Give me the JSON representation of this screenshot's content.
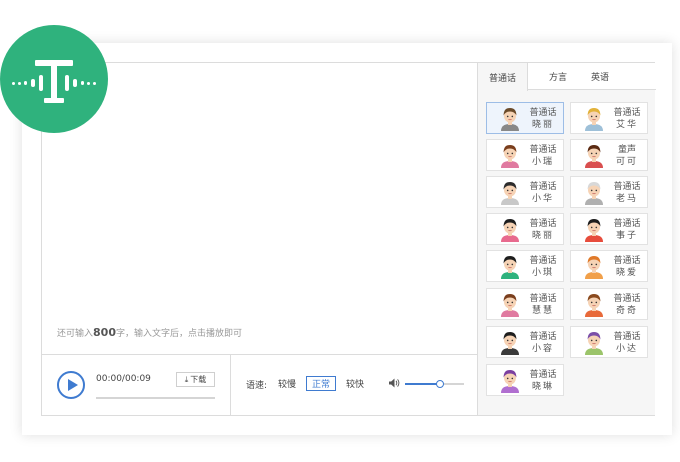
{
  "editor": {
    "hint_prefix": "还可输入",
    "hint_count": "800",
    "hint_suffix": "字，输入文字后，点击播放即可"
  },
  "player": {
    "time": "00:00/00:09",
    "download_label": "下载",
    "progress": 0
  },
  "speed": {
    "label": "语速:",
    "options": [
      "较慢",
      "正常",
      "较快"
    ],
    "selected": "正常"
  },
  "volume": {
    "level": 0.6
  },
  "colors": {
    "brand_green": "#2fb27d",
    "accent_blue": "#3f7bd0"
  },
  "tabs": [
    {
      "label": "普通话",
      "active": true
    },
    {
      "label": "方言",
      "active": false
    },
    {
      "label": "英语",
      "active": false
    }
  ],
  "voices": [
    {
      "lang": "普通话",
      "name": "晓丽",
      "selected": true,
      "avatar": "woman-glasses-avatar"
    },
    {
      "lang": "普通话",
      "name": "艾华",
      "selected": false,
      "avatar": "blonde-man-avatar"
    },
    {
      "lang": "普通话",
      "name": "小瑞",
      "selected": false,
      "avatar": "woman-brown-hair-avatar"
    },
    {
      "lang": "童声",
      "name": "可可",
      "selected": false,
      "avatar": "child-girl-avatar"
    },
    {
      "lang": "普通话",
      "name": "小华",
      "selected": false,
      "avatar": "man-black-hair-avatar"
    },
    {
      "lang": "普通话",
      "name": "老马",
      "selected": false,
      "avatar": "old-man-avatar"
    },
    {
      "lang": "普通话",
      "name": "晓丽",
      "selected": false,
      "avatar": "woman-long-hair-avatar"
    },
    {
      "lang": "普通话",
      "name": "事子",
      "selected": false,
      "avatar": "girl-red-headband-avatar"
    },
    {
      "lang": "普通话",
      "name": "小琪",
      "selected": false,
      "avatar": "man-green-scarf-avatar"
    },
    {
      "lang": "普通话",
      "name": "晓爱",
      "selected": false,
      "avatar": "girl-orange-hair-avatar"
    },
    {
      "lang": "普通话",
      "name": "慧慧",
      "selected": false,
      "avatar": "woman-bun-avatar"
    },
    {
      "lang": "普通话",
      "name": "奇奇",
      "selected": false,
      "avatar": "boy-brown-hair-avatar"
    },
    {
      "lang": "普通话",
      "name": "小容",
      "selected": false,
      "avatar": "woman-black-bob-avatar"
    },
    {
      "lang": "普通话",
      "name": "小达",
      "selected": false,
      "avatar": "boy-purple-hat-avatar"
    },
    {
      "lang": "普通话",
      "name": "晓琳",
      "selected": false,
      "avatar": "woman-purple-hair-avatar"
    }
  ]
}
